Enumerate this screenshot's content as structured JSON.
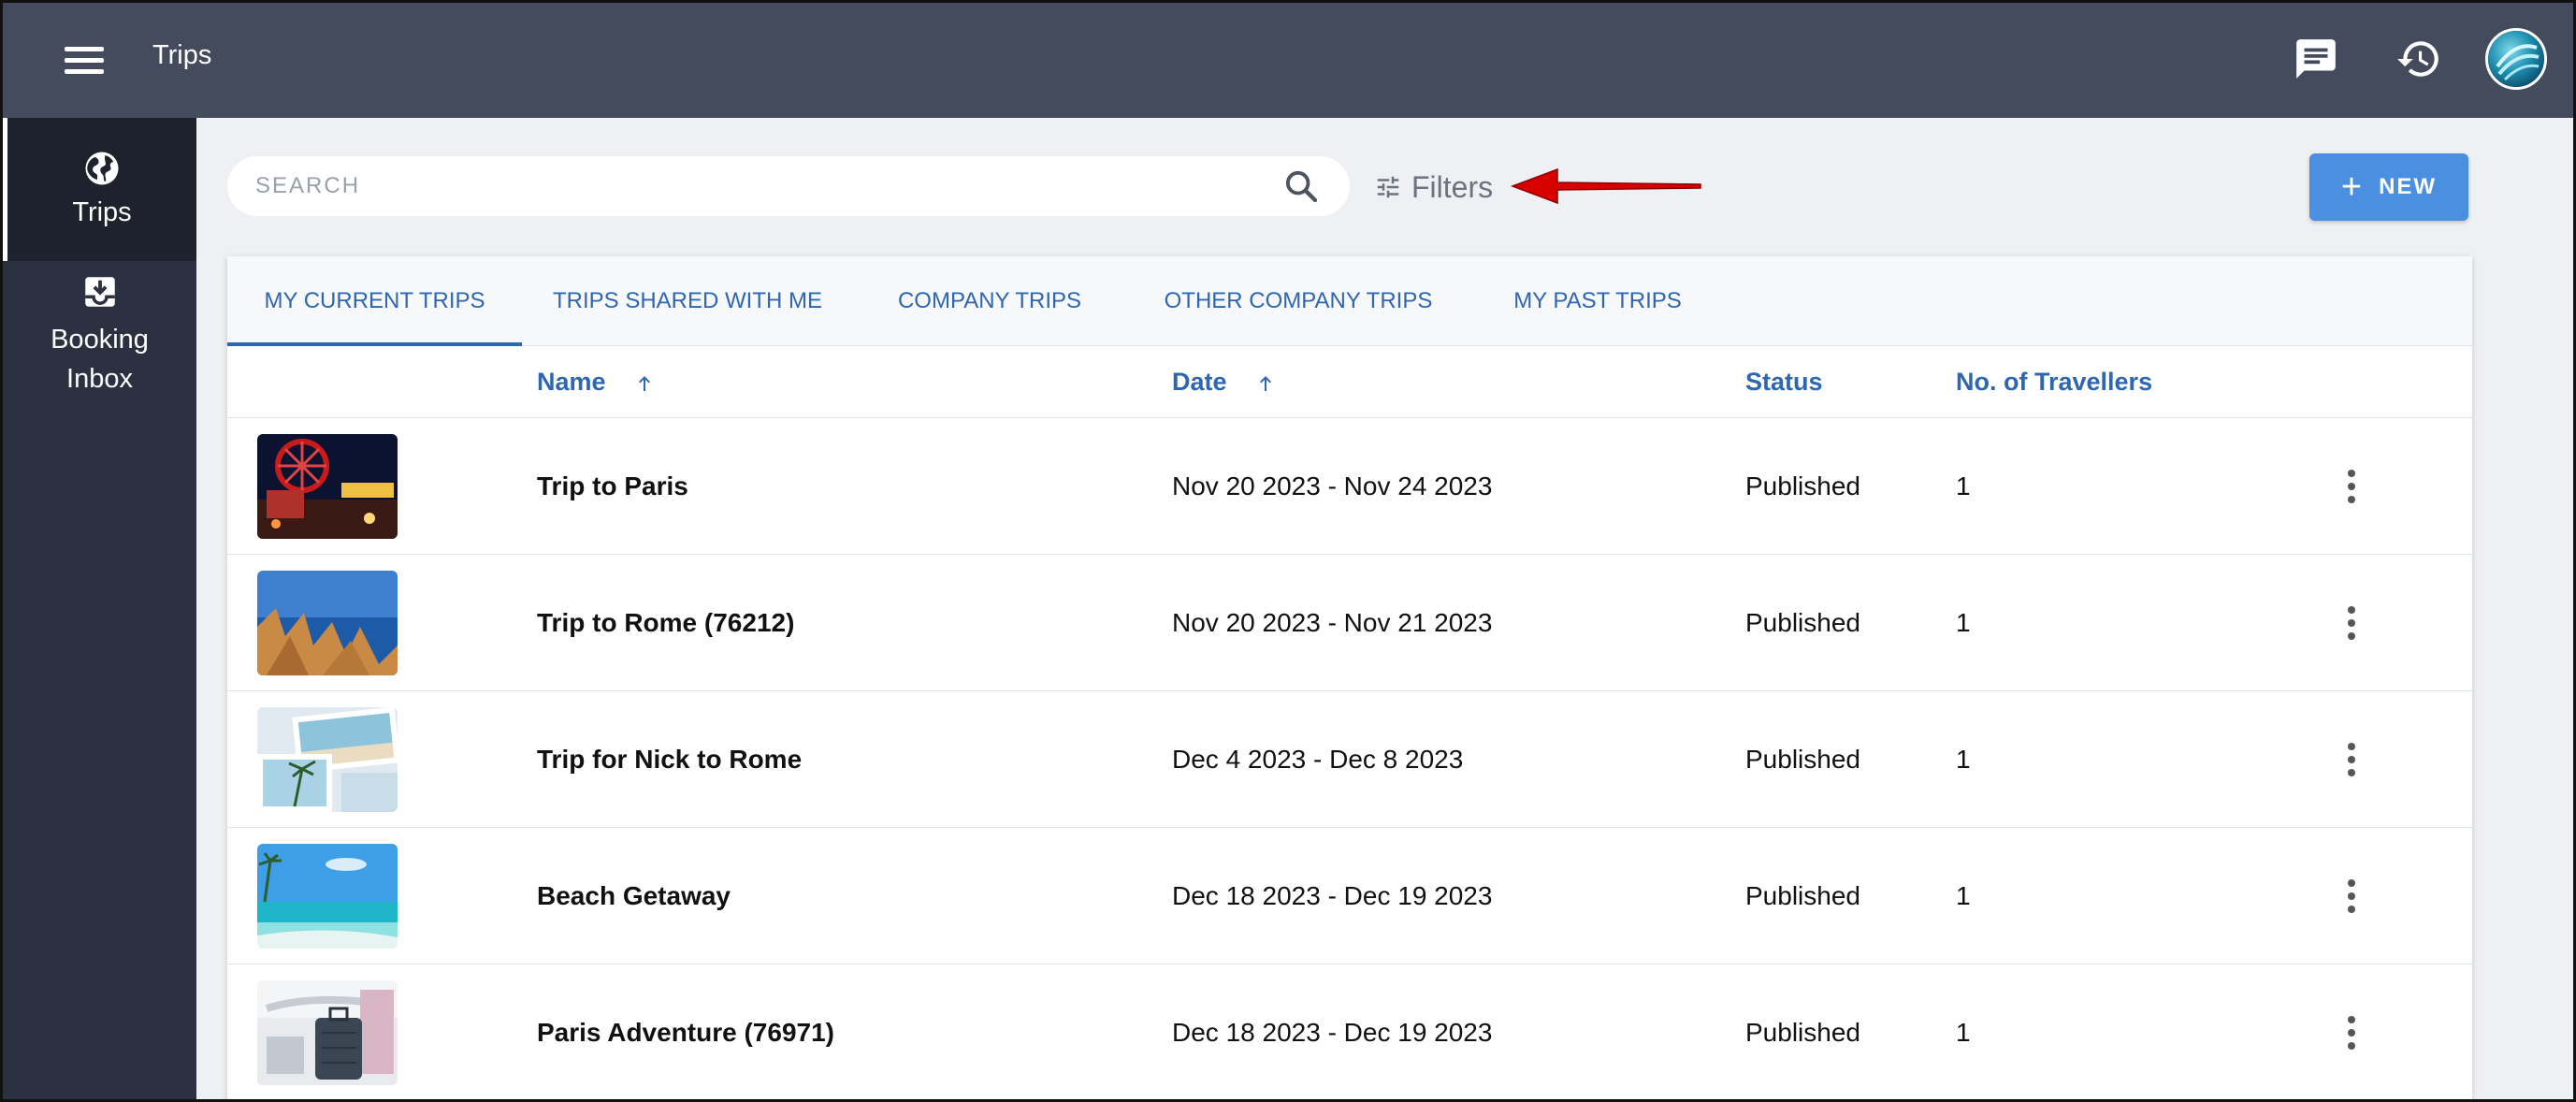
{
  "app": {
    "title": "Trips"
  },
  "topbar": {
    "menu_icon": "hamburger-menu-icon",
    "chat_icon": "chat-icon",
    "history_icon": "history-icon",
    "avatar_icon": "avatar"
  },
  "sidebar": {
    "items": [
      {
        "label": "Trips",
        "icon": "globe-icon",
        "active": true
      },
      {
        "label": "Booking Inbox",
        "icon": "inbox-download-icon",
        "active": false
      }
    ]
  },
  "search": {
    "placeholder": "SEARCH",
    "value": ""
  },
  "filters": {
    "label": "Filters",
    "icon": "tune-icon"
  },
  "new_button": {
    "label": "NEW",
    "icon": "plus-icon"
  },
  "tabs": [
    {
      "label": "MY CURRENT TRIPS",
      "active": true
    },
    {
      "label": "TRIPS SHARED WITH ME",
      "active": false
    },
    {
      "label": "COMPANY TRIPS",
      "active": false
    },
    {
      "label": "OTHER COMPANY TRIPS",
      "active": false
    },
    {
      "label": "MY PAST TRIPS",
      "active": false
    }
  ],
  "table": {
    "columns": {
      "name": "Name",
      "date": "Date",
      "status": "Status",
      "travellers": "No. of Travellers"
    },
    "rows": [
      {
        "name": "Trip to Paris",
        "date": "Nov 20 2023 - Nov 24 2023",
        "status": "Published",
        "travellers": "1",
        "thumbnail": "moulin-rouge-night"
      },
      {
        "name": "Trip to Rome (76212)",
        "date": "Nov 20 2023 - Nov 21 2023",
        "status": "Published",
        "travellers": "1",
        "thumbnail": "coastal-cliffs"
      },
      {
        "name": "Trip for Nick to Rome",
        "date": "Dec 4 2023 - Dec 8 2023",
        "status": "Published",
        "travellers": "1",
        "thumbnail": "beach-photos"
      },
      {
        "name": "Beach Getaway",
        "date": "Dec 18 2023 - Dec 19 2023",
        "status": "Published",
        "travellers": "1",
        "thumbnail": "tropical-beach"
      },
      {
        "name": "Paris Adventure (76971)",
        "date": "Dec 18 2023 - Dec 19 2023",
        "status": "Published",
        "travellers": "1",
        "thumbnail": "airport-luggage"
      }
    ]
  },
  "colors": {
    "topbar": "#434b5d",
    "sidebar": "#2b3140",
    "accent": "#2f66b0",
    "new_button": "#4a8fe0",
    "annotation_arrow": "#d90000"
  }
}
